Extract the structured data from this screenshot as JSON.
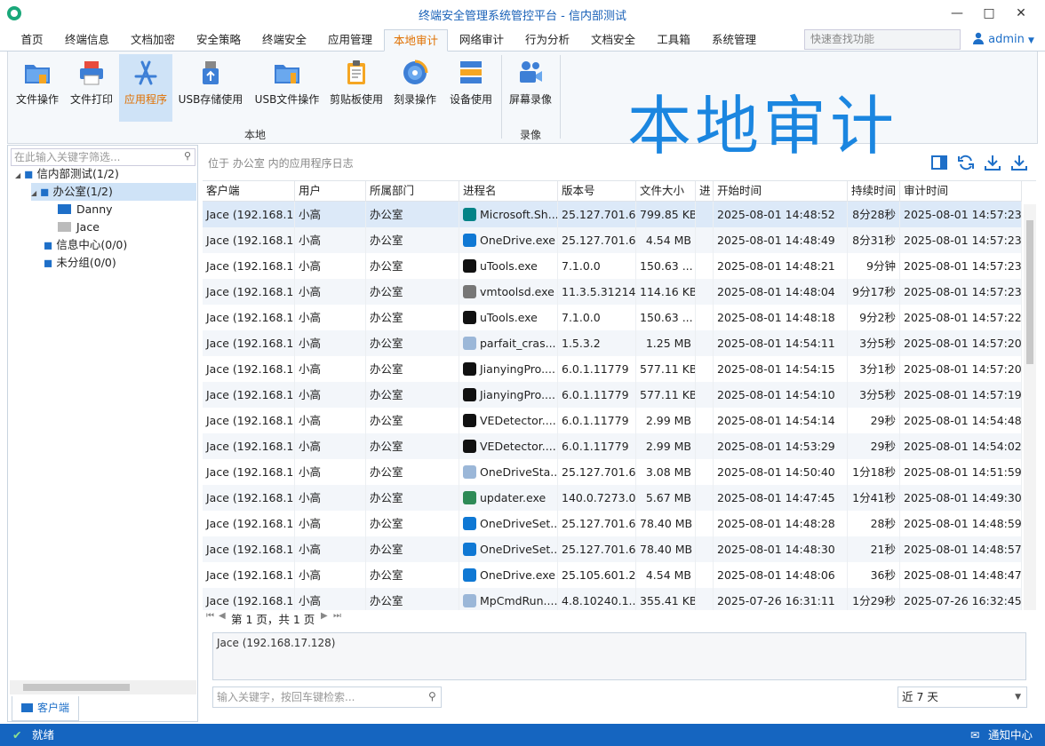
{
  "window": {
    "title": "终端安全管理系统管控平台 - 信内部测试"
  },
  "menu": {
    "items": [
      "首页",
      "终端信息",
      "文档加密",
      "安全策略",
      "终端安全",
      "应用管理",
      "本地审计",
      "网络审计",
      "行为分析",
      "文档安全",
      "工具箱",
      "系统管理"
    ],
    "active": "本地审计",
    "quick_search_placeholder": "快速查找功能",
    "user": "admin"
  },
  "ribbon": {
    "buttons": [
      "文件操作",
      "文件打印",
      "应用程序",
      "USB存储使用",
      "USB文件操作",
      "剪贴板使用",
      "刻录操作",
      "设备使用"
    ],
    "group_local": "本地",
    "record_button": "屏幕录像",
    "group_record": "录像",
    "big_title": "本地审计",
    "active": "应用程序"
  },
  "tree": {
    "filter_placeholder": "在此输入关键字筛选...",
    "nodes": [
      "信内部测试(1/2)",
      "办公室(1/2)",
      "Danny",
      "Jace",
      "信息中心(0/0)",
      "未分组(0/0)"
    ],
    "tab": "客户端"
  },
  "main": {
    "location": "位于 办公室 内的应用程序日志",
    "columns": [
      "客户端",
      "用户",
      "所属部门",
      "进程名",
      "版本号",
      "文件大小",
      "进",
      "开始时间",
      "持续时间",
      "审计时间"
    ],
    "rows": [
      [
        "Jace (192.168.1...",
        "小高",
        "办公室",
        "Microsoft.Sh...",
        "25.127.701.6",
        "799.85 KB",
        "",
        "2025-08-01 14:48:52",
        "8分28秒",
        "2025-08-01 14:57:23"
      ],
      [
        "Jace (192.168.1...",
        "小高",
        "办公室",
        "OneDrive.exe",
        "25.127.701.6",
        "4.54 MB",
        "",
        "2025-08-01 14:48:49",
        "8分31秒",
        "2025-08-01 14:57:23"
      ],
      [
        "Jace (192.168.1...",
        "小高",
        "办公室",
        "uTools.exe",
        "7.1.0.0",
        "150.63 ...",
        "",
        "2025-08-01 14:48:21",
        "9分钟",
        "2025-08-01 14:57:23"
      ],
      [
        "Jace (192.168.1...",
        "小高",
        "办公室",
        "vmtoolsd.exe",
        "11.3.5.31214",
        "114.16 KB",
        "",
        "2025-08-01 14:48:04",
        "9分17秒",
        "2025-08-01 14:57:23"
      ],
      [
        "Jace (192.168.1...",
        "小高",
        "办公室",
        "uTools.exe",
        "7.1.0.0",
        "150.63 ...",
        "",
        "2025-08-01 14:48:18",
        "9分2秒",
        "2025-08-01 14:57:22"
      ],
      [
        "Jace (192.168.1...",
        "小高",
        "办公室",
        "parfait_cras...",
        "1.5.3.2",
        "1.25 MB",
        "",
        "2025-08-01 14:54:11",
        "3分5秒",
        "2025-08-01 14:57:20"
      ],
      [
        "Jace (192.168.1...",
        "小高",
        "办公室",
        "JianyingPro....",
        "6.0.1.11779",
        "577.11 KB",
        "",
        "2025-08-01 14:54:15",
        "3分1秒",
        "2025-08-01 14:57:20"
      ],
      [
        "Jace (192.168.1...",
        "小高",
        "办公室",
        "JianyingPro....",
        "6.0.1.11779",
        "577.11 KB",
        "",
        "2025-08-01 14:54:10",
        "3分5秒",
        "2025-08-01 14:57:19"
      ],
      [
        "Jace (192.168.1...",
        "小高",
        "办公室",
        "VEDetector....",
        "6.0.1.11779",
        "2.99 MB",
        "",
        "2025-08-01 14:54:14",
        "29秒",
        "2025-08-01 14:54:48"
      ],
      [
        "Jace (192.168.1...",
        "小高",
        "办公室",
        "VEDetector....",
        "6.0.1.11779",
        "2.99 MB",
        "",
        "2025-08-01 14:53:29",
        "29秒",
        "2025-08-01 14:54:02"
      ],
      [
        "Jace (192.168.1...",
        "小高",
        "办公室",
        "OneDriveSta...",
        "25.127.701.6",
        "3.08 MB",
        "",
        "2025-08-01 14:50:40",
        "1分18秒",
        "2025-08-01 14:51:59"
      ],
      [
        "Jace (192.168.1...",
        "小高",
        "办公室",
        "updater.exe",
        "140.0.7273.0",
        "5.67 MB",
        "",
        "2025-08-01 14:47:45",
        "1分41秒",
        "2025-08-01 14:49:30"
      ],
      [
        "Jace (192.168.1...",
        "小高",
        "办公室",
        "OneDriveSet...",
        "25.127.701.6",
        "78.40 MB",
        "",
        "2025-08-01 14:48:28",
        "28秒",
        "2025-08-01 14:48:59"
      ],
      [
        "Jace (192.168.1...",
        "小高",
        "办公室",
        "OneDriveSet...",
        "25.127.701.6",
        "78.40 MB",
        "",
        "2025-08-01 14:48:30",
        "21秒",
        "2025-08-01 14:48:57"
      ],
      [
        "Jace (192.168.1...",
        "小高",
        "办公室",
        "OneDrive.exe",
        "25.105.601.2",
        "4.54 MB",
        "",
        "2025-08-01 14:48:06",
        "36秒",
        "2025-08-01 14:48:47"
      ],
      [
        "Jace (192.168.1...",
        "小高",
        "办公室",
        "MpCmdRun....",
        "4.8.10240.1...",
        "355.41 KB",
        "",
        "2025-07-26 16:31:11",
        "1分29秒",
        "2025-07-26 16:32:45"
      ]
    ],
    "row_icons": [
      "sharepoint",
      "onedrive",
      "utools",
      "vm",
      "utools",
      "generic",
      "capcut",
      "capcut",
      "capcut",
      "capcut",
      "generic",
      "chrome",
      "onedrive",
      "onedrive",
      "onedrive",
      "generic"
    ],
    "pager": "第 1 页，共 1 页",
    "detail": "Jace (192.168.17.128)",
    "keyword_placeholder": "输入关键字，按回车键检索...",
    "range": "近 7 天"
  },
  "status": {
    "left": "就绪",
    "right": "通知中心"
  },
  "colors": {
    "accent": "#1565c0",
    "active_text": "#e07000",
    "big_title": "#1b86e0"
  }
}
